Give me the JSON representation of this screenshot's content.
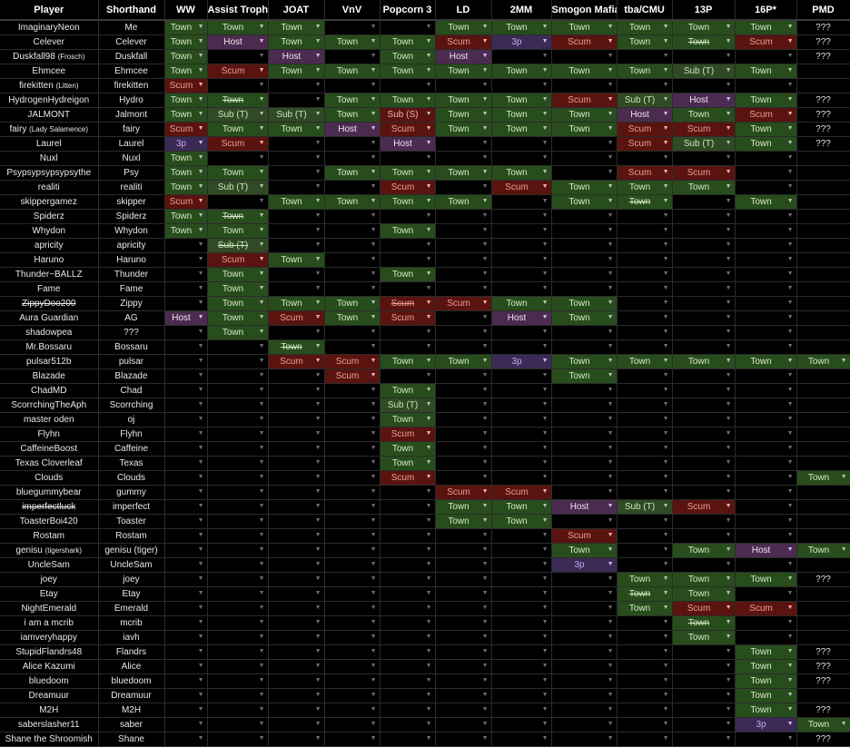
{
  "headers": [
    "Player",
    "Shorthand",
    "WW",
    "Assist Trophy",
    "JOAT",
    "VnV",
    "Popcorn 3",
    "LD",
    "2MM",
    "Smogon Mafia",
    "tba/CMU",
    "13P",
    "16P*",
    "PMD"
  ],
  "rows": [
    {
      "player": "ImaginaryNeon",
      "short": "Me",
      "c": [
        "Town",
        "Town",
        "Town",
        "",
        "",
        "Town",
        "Town",
        "Town",
        "Town",
        "Town",
        "Town",
        "???"
      ]
    },
    {
      "player": "Celever",
      "short": "Celever",
      "c": [
        "Town",
        "Host",
        "Town",
        "Town",
        "Town",
        "Scum",
        "3p",
        "Scum",
        "Town",
        "~Town",
        "Scum",
        "???"
      ]
    },
    {
      "player": "Duskfall98",
      "small": "(Frosch)",
      "short": "Duskfall",
      "c": [
        "Town",
        "",
        "Host",
        "",
        "Town",
        "Host",
        "",
        "",
        "",
        "",
        "",
        "???"
      ]
    },
    {
      "player": "Ehmcee",
      "short": "Ehmcee",
      "c": [
        "Town",
        "Scum",
        "Town",
        "Town",
        "Town",
        "Town",
        "Town",
        "Town",
        "Town",
        "Sub (T)",
        "Town",
        ""
      ]
    },
    {
      "player": "firekitten",
      "small": "(Litten)",
      "short": "firekitten",
      "c": [
        "Scum",
        "",
        "",
        "",
        "",
        "",
        "",
        "",
        "",
        "",
        "",
        ""
      ]
    },
    {
      "player": "HydrogenHydreigon",
      "short": "Hydro",
      "c": [
        "Town",
        "~Town",
        "",
        "Town",
        "Town",
        "Town",
        "Town",
        "Scum",
        "Sub (T)",
        "Host",
        "Town",
        "???"
      ]
    },
    {
      "player": "JALMONT",
      "short": "Jalmont",
      "c": [
        "Town",
        "Sub (T)",
        "Sub (T)",
        "Town",
        "Sub (S)",
        "Town",
        "Town",
        "Town",
        "Host",
        "Town",
        "Scum",
        "???"
      ]
    },
    {
      "player": "fairy",
      "small": "(Lady Salamence)",
      "short": "fairy",
      "c": [
        "Scum",
        "Town",
        "Town",
        "Host",
        "Scum",
        "Town",
        "Town",
        "Town",
        "Scum",
        "Scum",
        "Town",
        "???"
      ]
    },
    {
      "player": "Laurel",
      "short": "Laurel",
      "c": [
        "3p",
        "Scum",
        "",
        "",
        "Host",
        "",
        "",
        "",
        "Scum",
        "Sub (T)",
        "Town",
        "???"
      ]
    },
    {
      "player": "Nuxl",
      "short": "Nuxl",
      "c": [
        "Town",
        "",
        "",
        "",
        "",
        "",
        "",
        "",
        "",
        "",
        "",
        ""
      ]
    },
    {
      "player": "Psypsypsypsypsythe",
      "short": "Psy",
      "c": [
        "Town",
        "Town",
        "",
        "Town",
        "Town",
        "Town",
        "Town",
        "",
        "Scum",
        "Scum",
        "",
        ""
      ]
    },
    {
      "player": "realiti",
      "short": "realiti",
      "c": [
        "Town",
        "Sub (T)",
        "",
        "",
        "Scum",
        "",
        "Scum",
        "Town",
        "Town",
        "Town",
        "",
        ""
      ]
    },
    {
      "player": "skippergamez",
      "short": "skipper",
      "c": [
        "Scum",
        "",
        "Town",
        "Town",
        "Town",
        "Town",
        "",
        "Town",
        "~Town",
        "",
        "Town",
        ""
      ]
    },
    {
      "player": "Spiderz",
      "short": "Spiderz",
      "c": [
        "Town",
        "~Town",
        "",
        "",
        "",
        "",
        "",
        "",
        "",
        "",
        "",
        ""
      ]
    },
    {
      "player": "Whydon",
      "short": "Whydon",
      "c": [
        "Town",
        "Town",
        "",
        "",
        "Town",
        "",
        "",
        "",
        "",
        "",
        "",
        ""
      ]
    },
    {
      "player": "apricity",
      "short": "apricity",
      "c": [
        "",
        "~Sub (T)",
        "",
        "",
        "",
        "",
        "",
        "",
        "",
        "",
        "",
        ""
      ]
    },
    {
      "player": "Haruno",
      "short": "Haruno",
      "c": [
        "",
        "Scum",
        "Town",
        "",
        "",
        "",
        "",
        "",
        "",
        "",
        "",
        ""
      ]
    },
    {
      "player": "Thunder~BALLZ",
      "short": "Thunder",
      "c": [
        "",
        "Town",
        "",
        "",
        "Town",
        "",
        "",
        "",
        "",
        "",
        "",
        ""
      ]
    },
    {
      "player": "Fame",
      "short": "Fame",
      "c": [
        "",
        "Town",
        "",
        "",
        "",
        "",
        "",
        "",
        "",
        "",
        "",
        ""
      ]
    },
    {
      "player": "ZippyDoo200",
      "strike": true,
      "short": "Zippy",
      "c": [
        "",
        "Town",
        "Town",
        "Town",
        "~Scum",
        "Scum",
        "Town",
        "Town",
        "",
        "",
        "",
        ""
      ]
    },
    {
      "player": "Aura Guardian",
      "short": "AG",
      "c": [
        "Host",
        "Town",
        "Scum",
        "Town",
        "Scum",
        "",
        "Host",
        "Town",
        "",
        "",
        "",
        ""
      ]
    },
    {
      "player": "shadowpea",
      "short": "???",
      "c": [
        "",
        "Town",
        "",
        "",
        "",
        "",
        "",
        "",
        "",
        "",
        "",
        ""
      ]
    },
    {
      "player": "Mr.Bossaru",
      "short": "Bossaru",
      "c": [
        "",
        "",
        "~Town",
        "",
        "",
        "",
        "",
        "",
        "",
        "",
        "",
        ""
      ]
    },
    {
      "player": "pulsar512b",
      "short": "pulsar",
      "c": [
        "",
        "",
        "Scum",
        "Scum",
        "Town",
        "Town",
        "3p",
        "Town",
        "Town",
        "Town",
        "Town",
        "Town"
      ]
    },
    {
      "player": "Blazade",
      "short": "Blazade",
      "c": [
        "",
        "",
        "",
        "Scum",
        "",
        "",
        "",
        "Town",
        "",
        "",
        "",
        ""
      ]
    },
    {
      "player": "ChadMD",
      "short": "Chad",
      "c": [
        "",
        "",
        "",
        "",
        "Town",
        "",
        "",
        "",
        "",
        "",
        "",
        ""
      ]
    },
    {
      "player": "ScorrchingTheAph",
      "short": "Scorrching",
      "c": [
        "",
        "",
        "",
        "",
        "Sub (T)",
        "",
        "",
        "",
        "",
        "",
        "",
        ""
      ]
    },
    {
      "player": "master oden",
      "short": "oj",
      "c": [
        "",
        "",
        "",
        "",
        "Town",
        "",
        "",
        "",
        "",
        "",
        "",
        ""
      ]
    },
    {
      "player": "Flyhn",
      "short": "Flyhn",
      "c": [
        "",
        "",
        "",
        "",
        "Scum",
        "",
        "",
        "",
        "",
        "",
        "",
        ""
      ]
    },
    {
      "player": "CaffeineBoost",
      "short": "Caffeine",
      "c": [
        "",
        "",
        "",
        "",
        "Town",
        "",
        "",
        "",
        "",
        "",
        "",
        ""
      ]
    },
    {
      "player": "Texas Cloverleaf",
      "short": "Texas",
      "c": [
        "",
        "",
        "",
        "",
        "Town",
        "",
        "",
        "",
        "",
        "",
        "",
        ""
      ]
    },
    {
      "player": "Clouds",
      "short": "Clouds",
      "c": [
        "",
        "",
        "",
        "",
        "Scum",
        "",
        "",
        "",
        "",
        "",
        "",
        "Town"
      ]
    },
    {
      "player": "bluegummybear",
      "short": "gummy",
      "c": [
        "",
        "",
        "",
        "",
        "",
        "Scum",
        "Scum",
        "",
        "",
        "",
        "",
        ""
      ]
    },
    {
      "player": "imperfectluck",
      "strike": true,
      "short": "imperfect",
      "c": [
        "",
        "",
        "",
        "",
        "",
        "Town",
        "Town",
        "Host",
        "Sub (T)",
        "Scum",
        "",
        ""
      ]
    },
    {
      "player": "ToasterBoi420",
      "short": "Toaster",
      "c": [
        "",
        "",
        "",
        "",
        "",
        "Town",
        "Town",
        "",
        "",
        "",
        "",
        ""
      ]
    },
    {
      "player": "Rostam",
      "short": "Rostam",
      "c": [
        "",
        "",
        "",
        "",
        "",
        "",
        "",
        "Scum",
        "",
        "",
        "",
        ""
      ]
    },
    {
      "player": "genisu",
      "small": "(tigershark)",
      "short": "genisu (tiger)",
      "c": [
        "",
        "",
        "",
        "",
        "",
        "",
        "",
        "Town",
        "",
        "Town",
        "Host",
        "Town"
      ]
    },
    {
      "player": "UncleSam",
      "short": "UncleSam",
      "c": [
        "",
        "",
        "",
        "",
        "",
        "",
        "",
        "3p",
        "",
        "",
        "",
        ""
      ]
    },
    {
      "player": "joey",
      "short": "joey",
      "c": [
        "",
        "",
        "",
        "",
        "",
        "",
        "",
        "",
        "Town",
        "Town",
        "Town",
        "???"
      ]
    },
    {
      "player": "Etay",
      "short": "Etay",
      "c": [
        "",
        "",
        "",
        "",
        "",
        "",
        "",
        "",
        "~Town",
        "Town",
        "",
        ""
      ]
    },
    {
      "player": "NightEmerald",
      "short": "Emerald",
      "c": [
        "",
        "",
        "",
        "",
        "",
        "",
        "",
        "",
        "Town",
        "Scum",
        "Scum",
        ""
      ]
    },
    {
      "player": "i am a mcrib",
      "short": "mcrib",
      "c": [
        "",
        "",
        "",
        "",
        "",
        "",
        "",
        "",
        "",
        "~Town",
        "",
        ""
      ]
    },
    {
      "player": "iamveryhappy",
      "short": "iavh",
      "c": [
        "",
        "",
        "",
        "",
        "",
        "",
        "",
        "",
        "",
        "Town",
        "",
        ""
      ]
    },
    {
      "player": "StupidFlandrs48",
      "short": "Flandrs",
      "c": [
        "",
        "",
        "",
        "",
        "",
        "",
        "",
        "",
        "",
        "",
        "Town",
        "???"
      ]
    },
    {
      "player": "Alice Kazumi",
      "short": "Alice",
      "c": [
        "",
        "",
        "",
        "",
        "",
        "",
        "",
        "",
        "",
        "",
        "Town",
        "???"
      ]
    },
    {
      "player": "bluedoom",
      "short": "bluedoom",
      "c": [
        "",
        "",
        "",
        "",
        "",
        "",
        "",
        "",
        "",
        "",
        "Town",
        "???"
      ]
    },
    {
      "player": "Dreamuur",
      "short": "Dreamuur",
      "c": [
        "",
        "",
        "",
        "",
        "",
        "",
        "",
        "",
        "",
        "",
        "Town",
        ""
      ]
    },
    {
      "player": "M2H",
      "short": "M2H",
      "c": [
        "",
        "",
        "",
        "",
        "",
        "",
        "",
        "",
        "",
        "",
        "Town",
        "???"
      ]
    },
    {
      "player": "saberslasher11",
      "short": "saber",
      "c": [
        "",
        "",
        "",
        "",
        "",
        "",
        "",
        "",
        "",
        "",
        "3p",
        "Town"
      ]
    },
    {
      "player": "Shane the Shroomish",
      "short": "Shane",
      "c": [
        "",
        "",
        "",
        "",
        "",
        "",
        "",
        "",
        "",
        "",
        "",
        "???"
      ]
    }
  ],
  "icons": {
    "dropdown": "dropdown-arrow-icon"
  }
}
